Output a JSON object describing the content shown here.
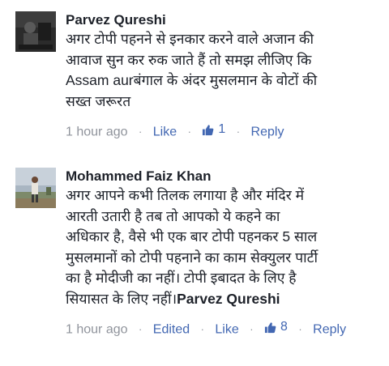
{
  "comments": [
    {
      "author": "Parvez Qureshi",
      "lines": [
        "अगर टोपी पहनने से इनकार करने वाले अजान की",
        "आवाज सुन कर रुक जाते हैं तो समझ लीजिए कि",
        "Assam aurबंगाल के अंदर मुसलमान के वोटों की",
        "सख्त जरूरत"
      ],
      "time": "1 hour ago",
      "like_label": "Like",
      "like_count": "1",
      "reply_label": "Reply"
    },
    {
      "author": "Mohammed Faiz Khan",
      "lines": [
        "अगर आपने कभी तिलक लगाया है और मंदिर में",
        "आरती उतारी है तब तो आपको ये कहने का",
        "अधिकार है, वैसे भी एक बार टोपी पहनकर 5 साल",
        "मुसलमानों को टोपी पहनाने का काम सेक्युलर पार्टी",
        "का है मोदीजी का नहीं। टोपी इबादत के लिए है",
        "सियासत के लिए नहीं।"
      ],
      "mention": "Parvez Qureshi",
      "time": "1 hour ago",
      "edited_label": "Edited",
      "like_label": "Like",
      "like_count": "8",
      "reply_label": "Reply"
    }
  ],
  "separator": "·",
  "colors": {
    "link": "#4267b2",
    "meta": "#90949c",
    "text": "#1d2129"
  },
  "icons": {
    "like": "thumbs-up-icon"
  }
}
